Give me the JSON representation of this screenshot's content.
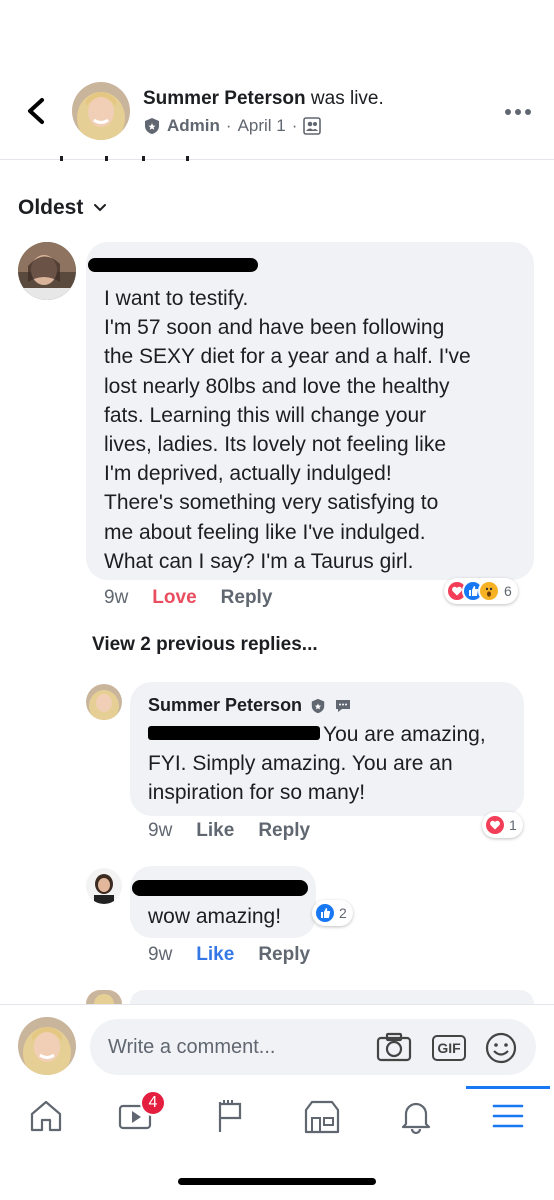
{
  "header": {
    "name": "Summer Peterson",
    "suffix": " was live.",
    "role": "Admin",
    "separator": "·",
    "date": "April 1",
    "separator2": "·"
  },
  "sort": {
    "label": "Oldest"
  },
  "comment1": {
    "lines": [
      "I want to testify.",
      "I'm 57 soon and have been following",
      "the SEXY diet for a year and a half. I've",
      "lost nearly 80lbs and love the healthy",
      "fats. Learning this will change your",
      "lives, ladies. Its lovely not feeling like",
      "I'm deprived, actually indulged!",
      "There's something very satisfying to",
      "me about feeling like I've indulged.",
      "What can I say? I'm a Taurus girl."
    ],
    "time": "9w",
    "love_label": "Love",
    "reply_label": "Reply",
    "reaction_count": "6"
  },
  "view_previous": "View 2 previous replies...",
  "reply1": {
    "name": "Summer Peterson",
    "line1_rest": "You are amazing,",
    "line2": "FYI. Simply amazing. You are an",
    "line3": "inspiration for so many!",
    "time": "9w",
    "like_label": "Like",
    "reply_label": "Reply",
    "reaction_count": "1"
  },
  "reply2": {
    "text": "wow amazing!",
    "reaction_count": "2",
    "time": "9w",
    "like_label": "Like",
    "reply_label": "Reply"
  },
  "compose": {
    "placeholder": "Write a comment...",
    "gif_label": "GIF"
  },
  "tabbar": {
    "video_badge": "4"
  },
  "colors": {
    "accent": "#1877f2",
    "love": "#e94e5f",
    "bubble": "#f0f2f5",
    "badge": "#e41e3f"
  }
}
